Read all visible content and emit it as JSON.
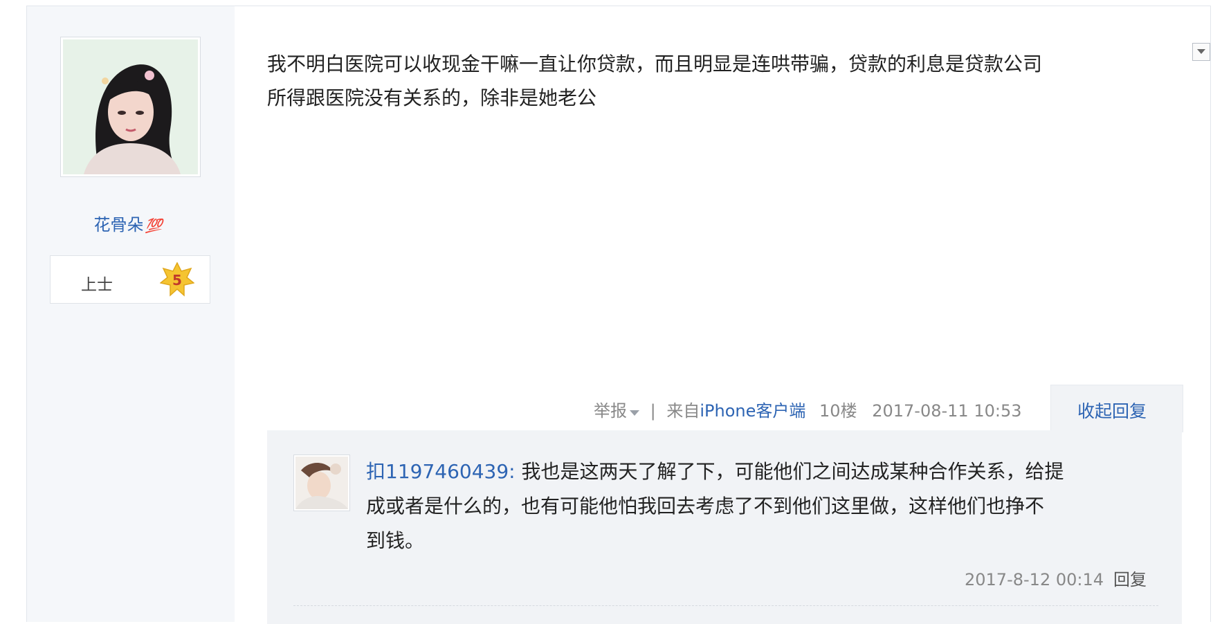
{
  "user": {
    "name": "花骨朵",
    "emoji": "💯",
    "rank": "上士",
    "level": "5"
  },
  "post": {
    "line1": "我不明白医院可以收现金干嘛一直让你贷款，而且明显是连哄带骗，贷款的利息是贷款公司",
    "line2": "所得跟医院没有关系的，除非是她老公"
  },
  "meta": {
    "report": "举报",
    "separator": "|",
    "from_prefix": "来自",
    "client": "iPhone客户端",
    "floor": "10楼",
    "time": "2017-08-11 10:53",
    "collapse": "收起回复"
  },
  "reply": {
    "user": "扣1197460439",
    "colon": ":",
    "line1": "我也是这两天了解了下，可能他们之间达成某种合作关系，给提",
    "line2": "成或者是什么的，也有可能他怕我回去考虑了不到他们这里做，这样他们也挣不",
    "line3": "到钱。",
    "time": "2017-8-12 00:14",
    "reply_label": "回复"
  },
  "colors": {
    "link": "#2d64b3",
    "meta": "#888888",
    "reply_bg": "#f1f3f6",
    "sidebar_bg": "#f5f7fa"
  }
}
